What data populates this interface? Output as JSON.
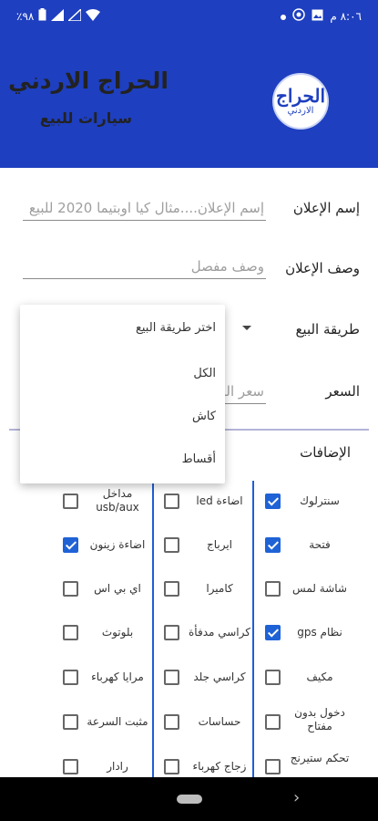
{
  "status_bar": {
    "time": "٨:٠٦ م",
    "battery": "٪٩٨",
    "icons": [
      "whatsapp-icon",
      "photo-icon",
      "notification-dot-icon",
      "wifi-icon",
      "signal-icon",
      "signal-icon",
      "battery-icon"
    ]
  },
  "header": {
    "logo_line1": "الحراج",
    "logo_line2": "الاردني",
    "title": "الحراج الاردني",
    "subtitle": "سيارات للبيع",
    "background": "#1e3fbf"
  },
  "form": {
    "ad_name_label": "إسم الإعلان",
    "ad_name_placeholder": "إسم الإعلان....مثال كيا اوبتيما 2020 للبيع",
    "ad_desc_label": "وصف الإعلان",
    "ad_desc_placeholder": "وصف مفصل",
    "sale_method_label": "طريقة البيع",
    "price_label": "السعر",
    "price_placeholder": "سعر البيع",
    "extras_label": "الإضافات"
  },
  "dropdown": {
    "options": [
      "اختر طريقة البيع",
      "الكل",
      "كاش",
      "أقساط"
    ]
  },
  "extras": {
    "col1": [
      {
        "label": "سنترلوك",
        "checked": true
      },
      {
        "label": "فتحة",
        "checked": true
      },
      {
        "label": "شاشة لمس",
        "checked": false
      },
      {
        "label": "نظام gps",
        "checked": true
      },
      {
        "label": "مكيف",
        "checked": false
      },
      {
        "label": "دخول بدون مفتاح",
        "checked": false
      },
      {
        "label": "تحكم ستيرنج",
        "checked": false
      }
    ],
    "col2": [
      {
        "label": "اضاءة led",
        "checked": false
      },
      {
        "label": "ايرباج",
        "checked": false
      },
      {
        "label": "كاميرا",
        "checked": false
      },
      {
        "label": "كراسي مدفأة",
        "checked": false
      },
      {
        "label": "كراسي جلد",
        "checked": false
      },
      {
        "label": "حساسات",
        "checked": false
      },
      {
        "label": "زجاج كهرباء",
        "checked": false
      }
    ],
    "col3": [
      {
        "label": "مداخل usb/aux",
        "checked": false
      },
      {
        "label": "اضاءة زينون",
        "checked": true
      },
      {
        "label": "اي بي اس",
        "checked": false
      },
      {
        "label": "بلوتوث",
        "checked": false
      },
      {
        "label": "مرايا كهرباء",
        "checked": false
      },
      {
        "label": "مثبت السرعة",
        "checked": false
      },
      {
        "label": "رادار",
        "checked": false
      }
    ]
  }
}
